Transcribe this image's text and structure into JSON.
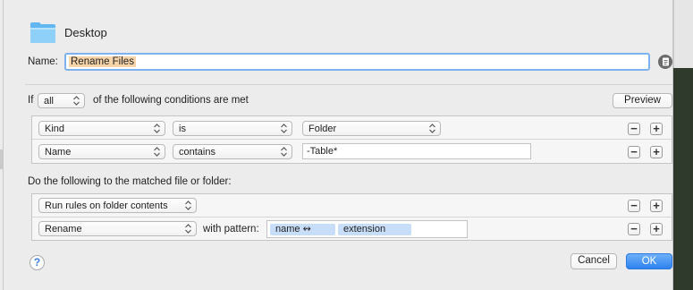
{
  "header": {
    "folder_name": "Desktop",
    "folder_icon": "folder-icon"
  },
  "name_field": {
    "label": "Name:",
    "value": "Rename Files"
  },
  "conditions": {
    "if_label": "If",
    "match_mode": "all",
    "suffix": "of the following conditions are met",
    "preview_label": "Preview",
    "rows": [
      {
        "field": "Kind",
        "operator": "is",
        "value": "Folder",
        "value_type": "popup"
      },
      {
        "field": "Name",
        "operator": "contains",
        "value": "-Table*",
        "value_type": "text"
      }
    ]
  },
  "actions": {
    "label": "Do the following to the matched file or folder:",
    "rows": [
      {
        "action": "Run rules on folder contents"
      },
      {
        "action": "Rename",
        "with_label": "with pattern:",
        "tokens": [
          "name ↭",
          "extension"
        ]
      }
    ]
  },
  "footer": {
    "help": "?",
    "cancel_label": "Cancel",
    "ok_label": "OK"
  },
  "buttons": {
    "minus": "−",
    "plus": "+"
  },
  "colors": {
    "accent": "#2d82ee",
    "selection": "#f6d3a8",
    "token": "#c8def8"
  }
}
